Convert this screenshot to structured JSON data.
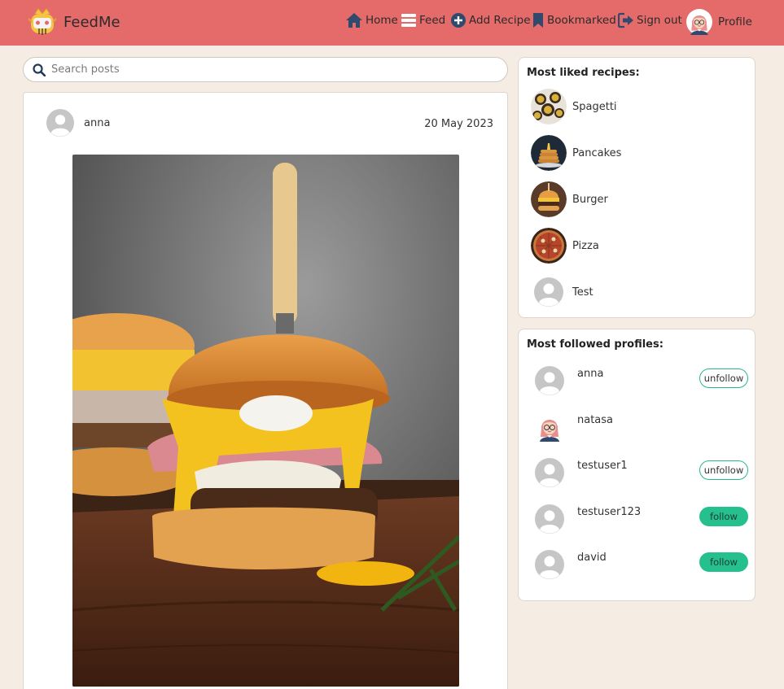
{
  "app": {
    "name": "FeedMe"
  },
  "nav": {
    "home": "Home",
    "feed": "Feed",
    "add_recipe": "Add Recipe",
    "bookmarked": "Bookmarked",
    "sign_out": "Sign out",
    "profile": "Profile"
  },
  "search": {
    "placeholder": "Search posts",
    "value": ""
  },
  "post": {
    "author": "anna",
    "date": "20 May 2023",
    "image": "burger-photo"
  },
  "most_liked": {
    "title": "Most liked recipes:",
    "items": [
      {
        "label": "Spagetti",
        "thumb": "spaghetti-thumbnail"
      },
      {
        "label": "Pancakes",
        "thumb": "pancakes-thumbnail"
      },
      {
        "label": "Burger",
        "thumb": "burger-thumbnail"
      },
      {
        "label": "Pizza",
        "thumb": "pizza-thumbnail"
      },
      {
        "label": "Test",
        "thumb": "default-avatar-icon"
      }
    ]
  },
  "most_followed": {
    "title": "Most followed profiles:",
    "items": [
      {
        "username": "anna",
        "button": "unfollow"
      },
      {
        "username": "natasa",
        "button": ""
      },
      {
        "username": "testuser1",
        "button": "unfollow"
      },
      {
        "username": "testuser123",
        "button": "follow"
      },
      {
        "username": "david",
        "button": "follow"
      }
    ]
  },
  "colors": {
    "navbar": "#e56b6b",
    "page_bg": "#f5ede3",
    "follow_green": "#26c08f",
    "icon_navy": "#2f4a6d"
  }
}
